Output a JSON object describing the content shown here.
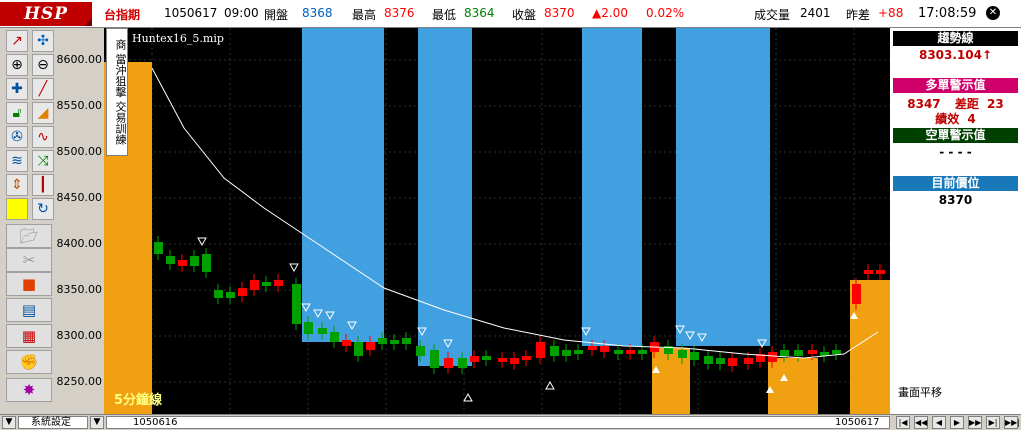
{
  "header": {
    "logo": "HSP",
    "symbol": "台指期",
    "date": "1050617",
    "time": "09:00",
    "open_label": "開盤",
    "open_value": "8368",
    "high_label": "最高",
    "high_value": "8376",
    "low_label": "最低",
    "low_value": "8364",
    "close_label": "收盤",
    "close_value": "8370",
    "change": "▲2.00",
    "change_pct": "0.02%",
    "volume_label": "成交量",
    "volume_value": "2401",
    "diff_label": "昨差",
    "diff_value": "+88",
    "clock": "17:08:59",
    "close_btn": "✕"
  },
  "chart": {
    "file_label": "Huntex16_5.mip",
    "side_vertical_text": "商 當沖狙擊 交易訓練",
    "interval_label": "5分鐘線",
    "y_ticks": [
      "8600.00",
      "8550.00",
      "8500.00",
      "8450.00",
      "8400.00",
      "8350.00",
      "8300.00",
      "8250.00"
    ]
  },
  "right_panel": {
    "trend_label": "趨勢線",
    "trend_value": "8303.104↑",
    "long_label": "多單警示值",
    "long_value": "8347",
    "long_diff_label": "差距",
    "long_diff_value": "23",
    "long_perf_label": "績效",
    "long_perf_value": "4",
    "short_label": "空單警示值",
    "short_value": "- - - -",
    "position_label": "目前價位",
    "position_value": "8370",
    "shift_label": "畫面平移"
  },
  "footer": {
    "settings_label": "系統設定",
    "left_date": "1050616",
    "right_date": "1050617"
  },
  "colors": {
    "up": "#ff0000",
    "down": "#00a000",
    "long_zone": "#f0a010",
    "short_zone": "#40a0e0",
    "trend_head": "#000000",
    "long_head": "#d0006a",
    "short_head": "#004000",
    "position_head": "#1878b8"
  }
}
